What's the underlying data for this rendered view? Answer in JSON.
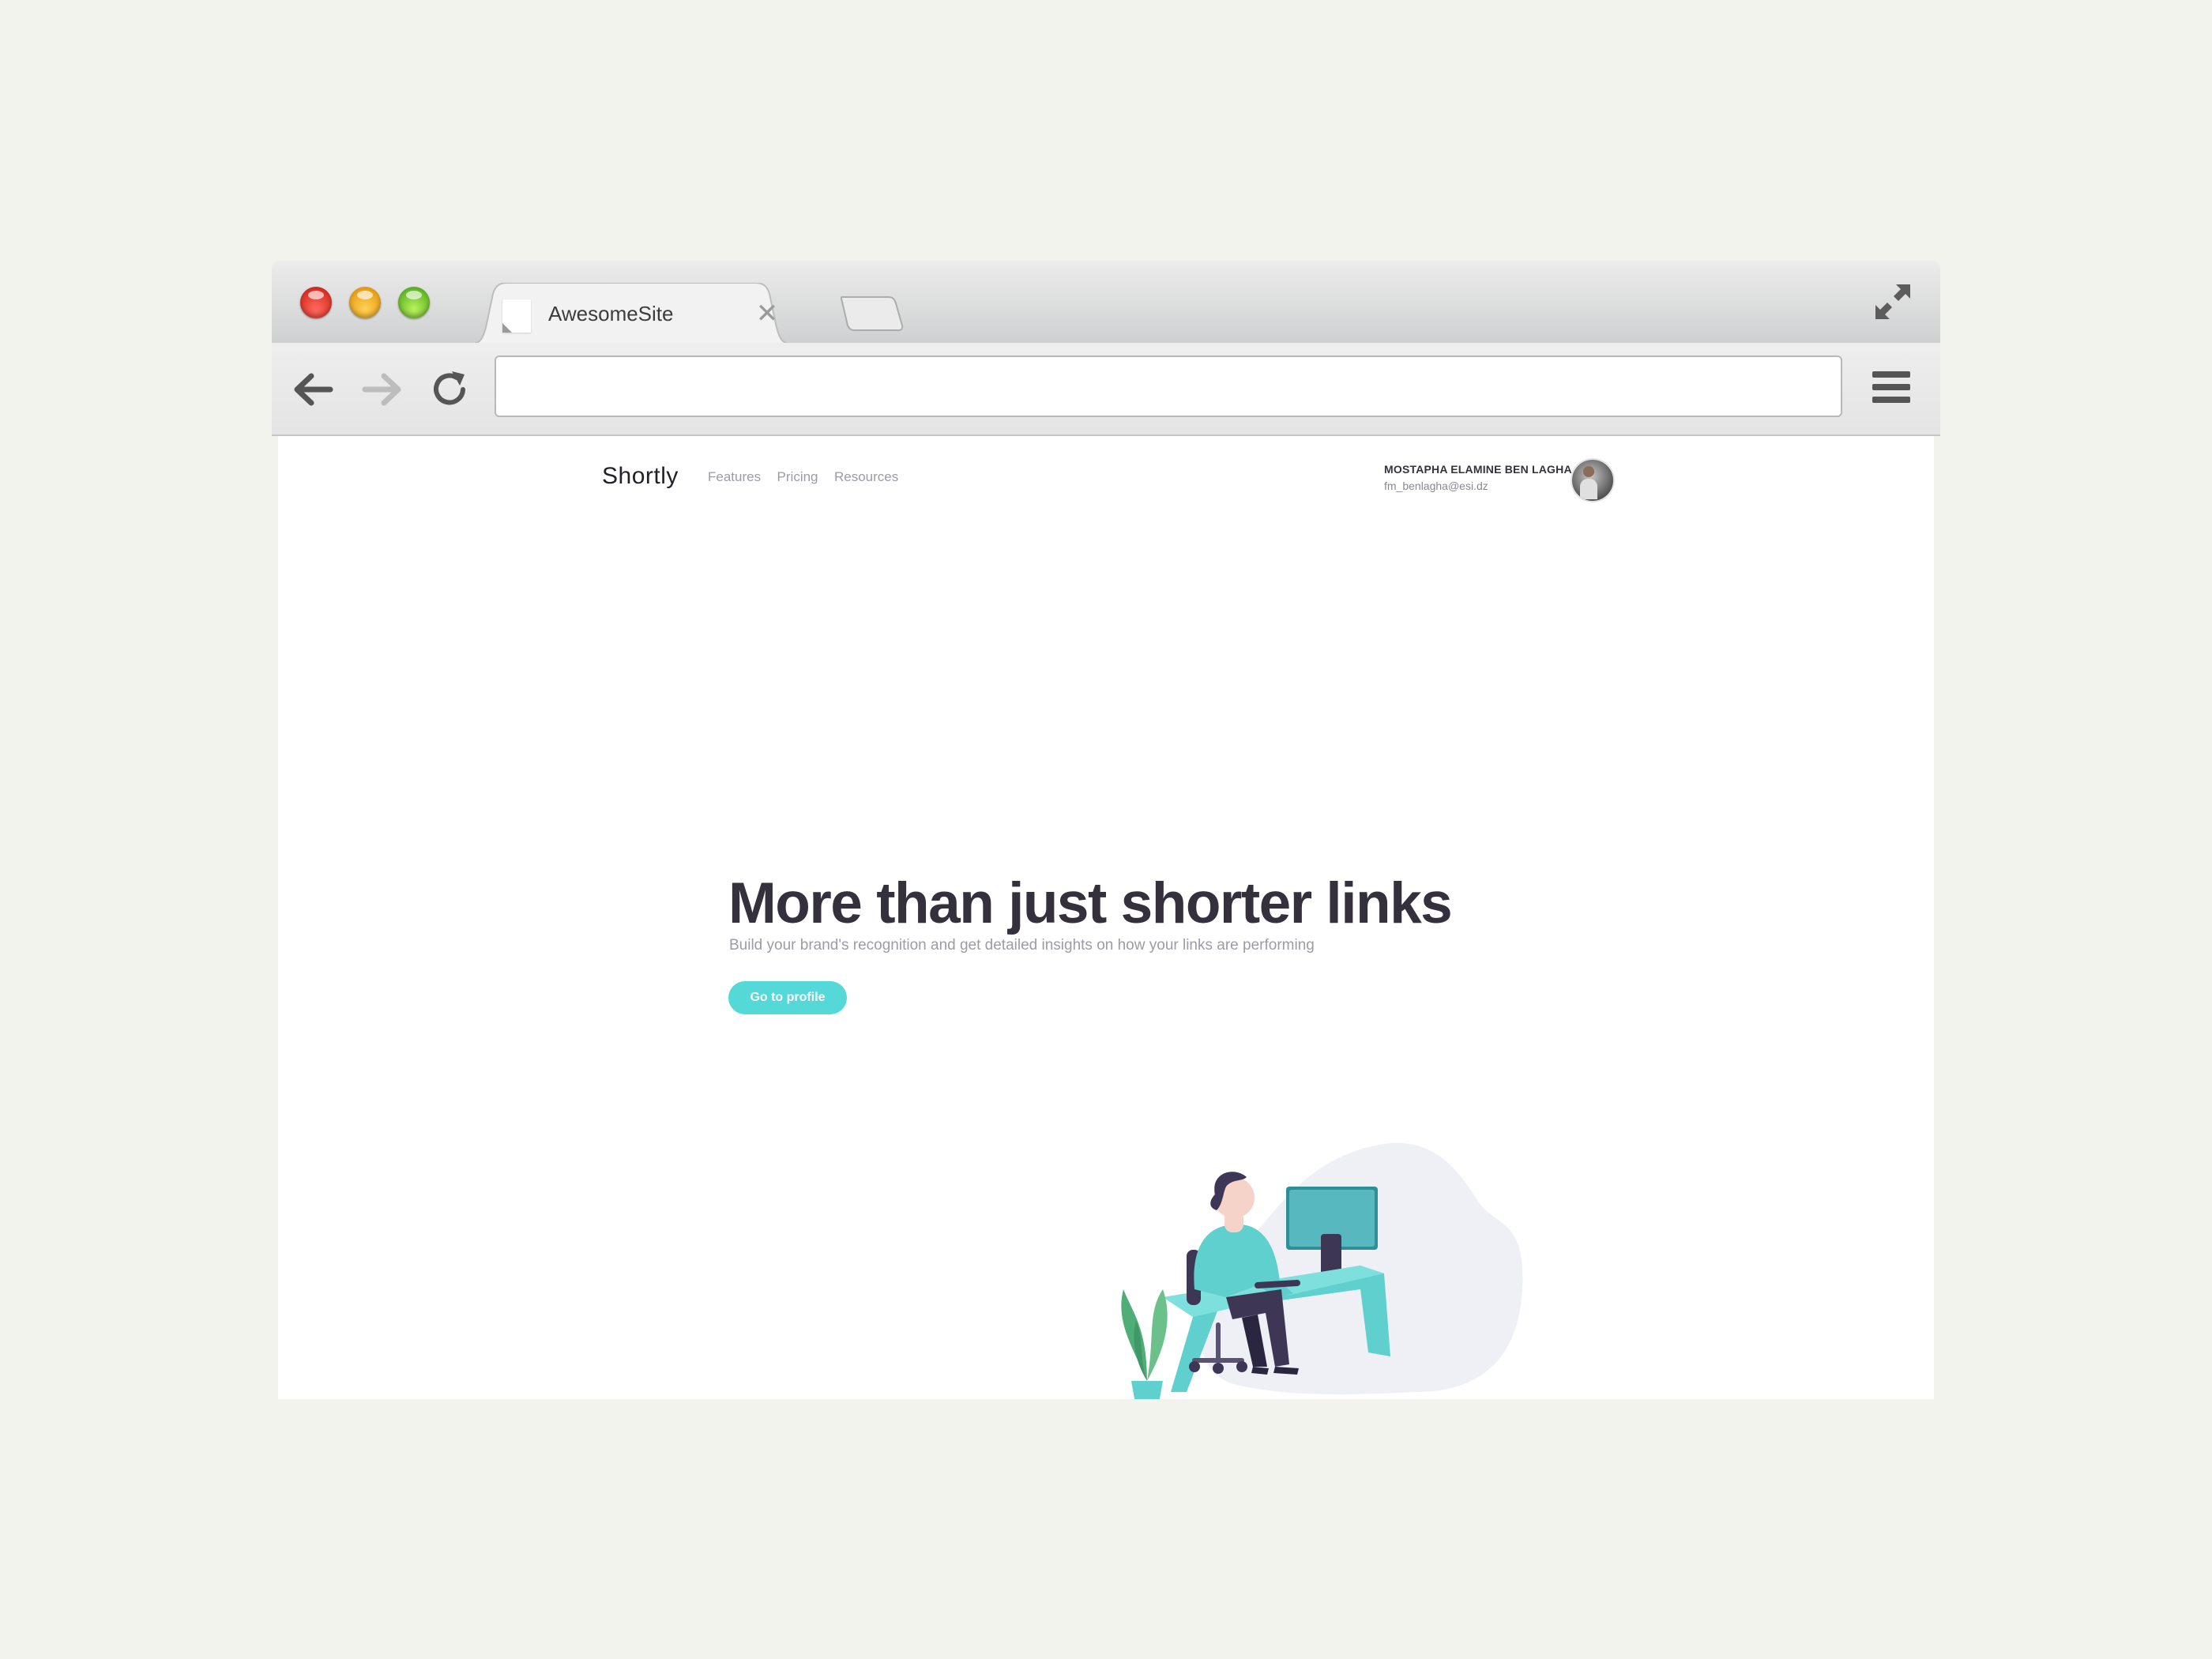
{
  "browser": {
    "tab_title": "AwesomeSite",
    "tab_close": "✕",
    "address_value": ""
  },
  "site": {
    "brand": "Shortly",
    "nav": [
      "Features",
      "Pricing",
      "Resources"
    ],
    "user": {
      "name": "MOSTAPHA ELAMINE BEN LAGHA",
      "email": "fm_benlagha@esi.dz"
    },
    "hero": {
      "title": "More than just shorter links",
      "subtitle": "Build your brand's recognition and get detailed insights on how your links are performing",
      "cta": "Go to profile"
    }
  },
  "colors": {
    "page_background": "#f3f3ed",
    "accent": "#2acfcf",
    "heading": "#34313d",
    "muted_text": "#9e9aa7"
  },
  "icons": [
    "back-arrow-icon",
    "forward-arrow-icon",
    "reload-icon",
    "hamburger-menu-icon",
    "fullscreen-icon",
    "favicon-icon",
    "close-icon"
  ]
}
